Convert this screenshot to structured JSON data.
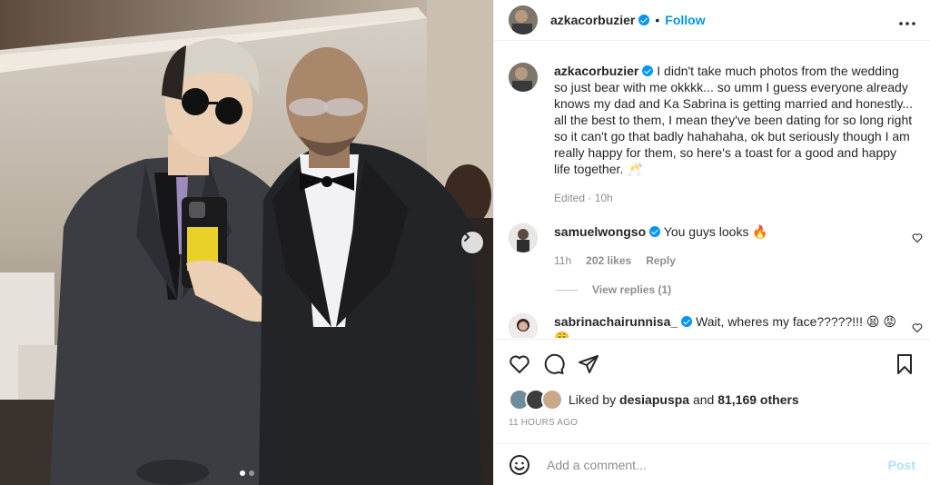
{
  "post": {
    "author": "azkacorbuzier",
    "separator": "•",
    "follow_label": "Follow",
    "more_label": "•••",
    "caption": "I didn't take much photos from the wedding so just bear with me okkkk... so umm I guess everyone already knows my dad and Ka Sabrina is getting married and honestly... all the best to them, I mean they've been dating for so long right so it can't go that badly hahahaha, ok but seriously though I am really happy for them, so here's a toast for a good and happy life together. 🥂",
    "edited": "Edited · 10h"
  },
  "comments": [
    {
      "username": "samuelwongso",
      "text": "You guys looks 🔥",
      "time": "11h",
      "likes": "202 likes",
      "reply_label": "Reply",
      "view_replies": "View replies (1)"
    },
    {
      "username": "sabrinachairunnisa_",
      "text": "Wait, wheres my face?????!!! 😫 😡 😤"
    }
  ],
  "likes": {
    "prefix": "Liked by",
    "user": "desiapuspa",
    "joiner": "and",
    "count": "81,169 others"
  },
  "timestamp": "11 HOURS AGO",
  "add_comment": {
    "placeholder": "Add a comment...",
    "post_label": "Post"
  },
  "carousel": {
    "total": 2,
    "current": 1
  },
  "colors": {
    "accent": "#0095f6",
    "post_disabled": "#b2dffc",
    "text": "#262626",
    "muted": "#8e8e8e"
  }
}
